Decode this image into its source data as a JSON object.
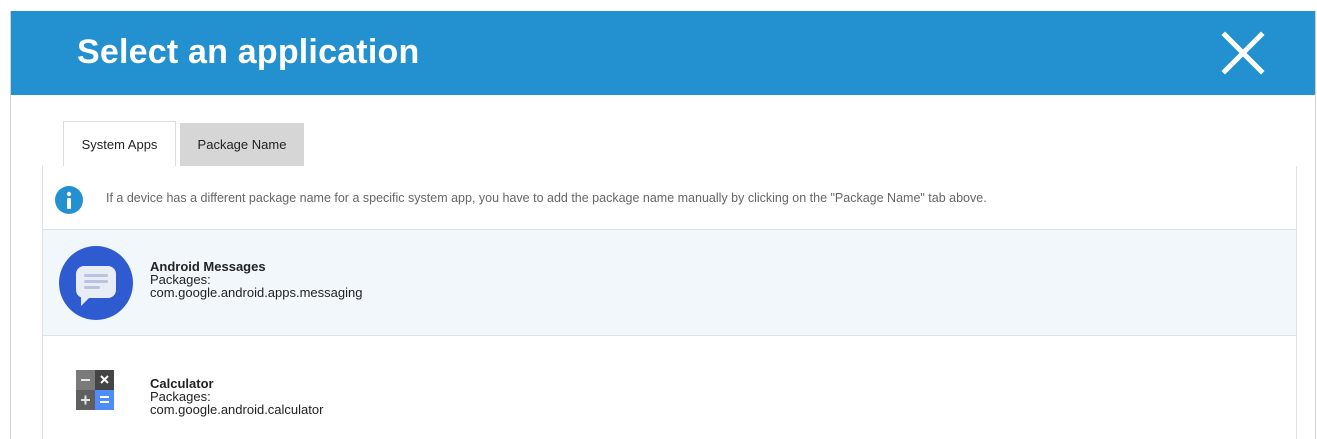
{
  "dialog": {
    "title": "Select an application",
    "close_icon": "close-icon",
    "header_color": "#2390cf"
  },
  "tabs": [
    {
      "label": "System Apps",
      "active": true
    },
    {
      "label": "Package Name",
      "active": false
    }
  ],
  "info": {
    "icon": "info-icon",
    "text": "If a device has a different package name for a specific system app, you have to add the package name manually by clicking on the \"Package Name\" tab above."
  },
  "apps": [
    {
      "name": "Android Messages",
      "packages_label": "Packages:",
      "package": "com.google.android.apps.messaging",
      "icon": "messages-icon",
      "selected": true
    },
    {
      "name": "Calculator",
      "packages_label": "Packages:",
      "package": "com.google.android.calculator",
      "icon": "calculator-icon",
      "selected": false
    }
  ]
}
